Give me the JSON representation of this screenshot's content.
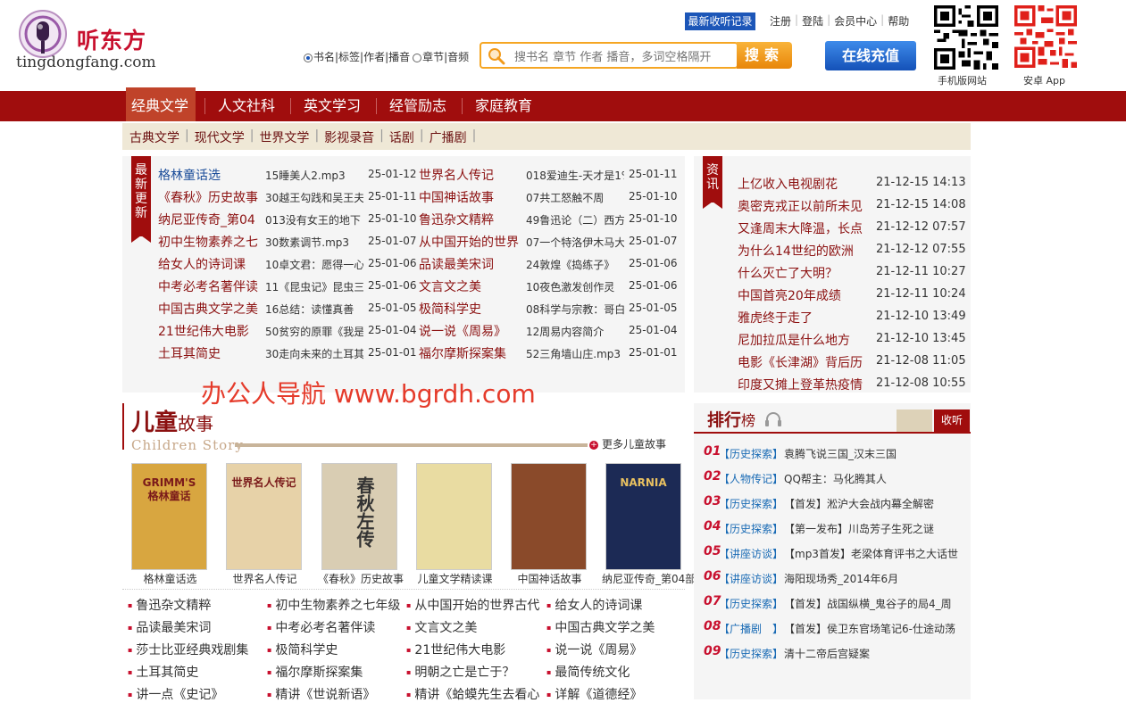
{
  "header": {
    "logo_cn": "听东方",
    "logo_domain": "tingdongfang.com",
    "recent_btn": "最新收听记录",
    "top_links": [
      "注册",
      "登陆",
      "会员中心",
      "帮助"
    ],
    "qr_mobile_label": "手机版网站",
    "qr_android_label": "安卓 App",
    "radio_book": "书名|标签|作者|播音",
    "radio_chapter": "章节|音频",
    "search_placeholder": "搜书名 章节 作者 播音，多词空格隔开",
    "search_btn": "搜索",
    "recharge_btn": "在线充值"
  },
  "nav": [
    "经典文学",
    "人文社科",
    "英文学习",
    "经管励志",
    "家庭教育"
  ],
  "subnav": [
    "古典文学",
    "现代文学",
    "世界文学",
    "影视录音",
    "话剧",
    "广播剧"
  ],
  "latest": {
    "ribbon": "最新更新",
    "left": [
      {
        "title": "格林童话选",
        "ep": "15睡美人2.mp3",
        "date": "25-01-12"
      },
      {
        "title": "《春秋》历史故事",
        "ep": "30越王勾践和吴王夫",
        "date": "25-01-11"
      },
      {
        "title": "纳尼亚传奇_第04",
        "ep": "013没有女王的地下",
        "date": "25-01-10"
      },
      {
        "title": "初中生物素养之七",
        "ep": "30数素调节.mp3",
        "date": "25-01-07"
      },
      {
        "title": "给女人的诗词课",
        "ep": "10卓文君：愿得一心",
        "date": "25-01-06"
      },
      {
        "title": "中考必考名著伴读",
        "ep": "11《昆虫记》昆虫三",
        "date": "25-01-06"
      },
      {
        "title": "中国古典文学之美",
        "ep": "16总结：读懂真善",
        "date": "25-01-05"
      },
      {
        "title": "21世纪伟大电影",
        "ep": "50贫穷的原罪《我是",
        "date": "25-01-04"
      },
      {
        "title": "土耳其简史",
        "ep": "30走向未来的土耳其",
        "date": "25-01-01"
      }
    ],
    "right": [
      {
        "title": "世界名人传记",
        "ep": "018爱迪生-天才是1%",
        "date": "25-01-11"
      },
      {
        "title": "中国神话故事",
        "ep": "07共工怒触不周",
        "date": "25-01-10"
      },
      {
        "title": "鲁迅杂文精粹",
        "ep": "49鲁迅论（二）西方",
        "date": "25-01-10"
      },
      {
        "title": "从中国开始的世界",
        "ep": "07一个特洛伊木马大",
        "date": "25-01-07"
      },
      {
        "title": "品读最美宋词",
        "ep": "24敦煌《捣练子》",
        "date": "25-01-06"
      },
      {
        "title": "文言文之美",
        "ep": "10夜色激发创作灵",
        "date": "25-01-06"
      },
      {
        "title": "极简科学史",
        "ep": "08科学与宗教：哥白",
        "date": "25-01-05"
      },
      {
        "title": "说一说《周易》",
        "ep": "12周易内容简介",
        "date": "25-01-04"
      },
      {
        "title": "福尔摩斯探案集",
        "ep": "52三角墙山庄.mp3",
        "date": "25-01-01"
      }
    ]
  },
  "watermark": "办公人导航 www.bgrdh.com",
  "news": {
    "ribbon": "资讯",
    "items": [
      {
        "title": "上亿收入电视剧花",
        "date": "21-12-15 14:13"
      },
      {
        "title": "奥密克戎正以前所未见",
        "date": "21-12-15 14:08"
      },
      {
        "title": "又逢周末大降温，长点",
        "date": "21-12-12 07:57"
      },
      {
        "title": "为什么14世纪的欧洲",
        "date": "21-12-12 07:55"
      },
      {
        "title": "什么灭亡了大明？",
        "date": "21-12-11 10:27"
      },
      {
        "title": "中国首亮20年成绩",
        "date": "21-12-11 10:24"
      },
      {
        "title": "雅虎终于走了",
        "date": "21-12-10 13:49"
      },
      {
        "title": "尼加拉瓜是什么地方",
        "date": "21-12-10 13:45"
      },
      {
        "title": "电影《长津湖》背后历",
        "date": "21-12-08 11:05"
      },
      {
        "title": "印度又摊上登革热疫情",
        "date": "21-12-08 10:55"
      }
    ]
  },
  "children": {
    "title_big": "儿童",
    "title_small": "故事",
    "subtitle": "Children Story",
    "more": "更多儿童故事",
    "books": [
      {
        "label": "格林童话选",
        "cover_text": "GRIMM'S 格林童话",
        "color": "#d8a640"
      },
      {
        "label": "世界名人传记",
        "cover_text": "世界名人传记",
        "color": "#e7d2a8"
      },
      {
        "label": "《春秋》历史故事",
        "cover_text": "春秋左传",
        "color": "#d9cdb3"
      },
      {
        "label": "儿童文学精读课",
        "cover_text": "",
        "color": "#e9dca2"
      },
      {
        "label": "中国神话故事",
        "cover_text": "",
        "color": "#8a4a2a"
      },
      {
        "label": "纳尼亚传奇_第04部",
        "cover_text": "NARNIA",
        "color": "#1c2a55"
      }
    ],
    "links": [
      [
        "鲁迅杂文精粹",
        "初中生物素养之七年级",
        "从中国开始的世界古代",
        "给女人的诗词课"
      ],
      [
        "品读最美宋词",
        "中考必考名著伴读",
        "文言文之美",
        "中国古典文学之美"
      ],
      [
        "莎士比亚经典戏剧集",
        "极简科学史",
        "21世纪伟大电影",
        "说一说《周易》"
      ],
      [
        "土耳其简史",
        "福尔摩斯探案集",
        "明朝之亡是亡于？",
        "最简传统文化"
      ],
      [
        "讲一点《史记》",
        "精讲《世说新语》",
        "精讲《蛤蟆先生去看心",
        "详解《道德经》"
      ]
    ]
  },
  "ranking": {
    "title_big": "排行",
    "title_small": "榜",
    "tab_active": "收听",
    "items": [
      {
        "num": "01",
        "cat": "【历史探索】",
        "title": "袁腾飞说三国_汉末三国"
      },
      {
        "num": "02",
        "cat": "【人物传记】",
        "title": "QQ帮主：马化腾其人"
      },
      {
        "num": "03",
        "cat": "【历史探索】",
        "title": "【首发】淞沪大会战内幕全解密"
      },
      {
        "num": "04",
        "cat": "【历史探索】",
        "title": "【第一发布】川岛芳子生死之谜"
      },
      {
        "num": "05",
        "cat": "【讲座访谈】",
        "title": "【mp3首发】老梁体育评书之大话世"
      },
      {
        "num": "06",
        "cat": "【讲座访谈】",
        "title": "海阳现场秀_2014年6月"
      },
      {
        "num": "07",
        "cat": "【历史探索】",
        "title": "【首发】战国纵横_鬼谷子的局4_周"
      },
      {
        "num": "08",
        "cat": "【广播剧　】",
        "title": "【首发】侯卫东官场笔记6-仕途动荡"
      },
      {
        "num": "09",
        "cat": "【历史探索】",
        "title": "清十二帝后宫疑案"
      }
    ]
  }
}
